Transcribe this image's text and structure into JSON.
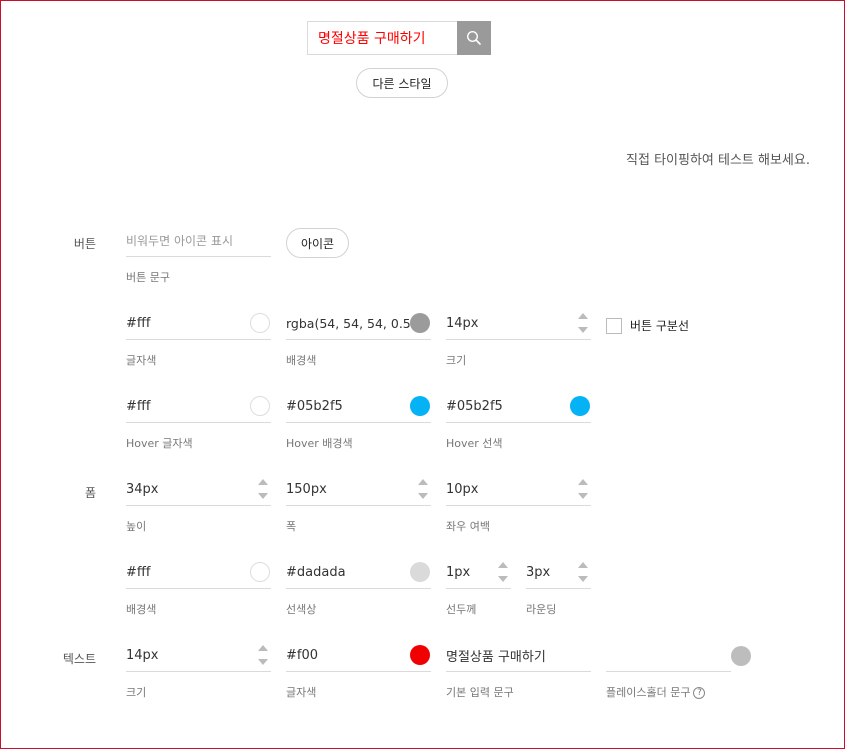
{
  "preview": {
    "input_value": "명절상품 구매하기",
    "text_color": "#f00",
    "button_bg": "rgba(54, 54, 54, 0.5)",
    "button_icon": "search-icon"
  },
  "other_style_label": "다른 스타일",
  "hint": "직접 타이핑하여 테스트 해보세요.",
  "sections": {
    "button": "버튼",
    "form": "폼",
    "text": "텍스트"
  },
  "button": {
    "text_placeholder": "비워두면 아이콘 표시",
    "text_label": "버튼 문구",
    "icon_button_label": "아이콘",
    "font_color": {
      "value": "#fff",
      "label": "글자색",
      "swatch": "#ffffff"
    },
    "bg_color": {
      "value": "rgba(54, 54, 54, 0.5)",
      "label": "배경색",
      "swatch": "#9b9b9b"
    },
    "size": {
      "value": "14px",
      "label": "크기"
    },
    "divider_checkbox": {
      "label": "버튼 구분선",
      "checked": false
    },
    "hover_font_color": {
      "value": "#fff",
      "label": "Hover 글자색",
      "swatch": "#ffffff"
    },
    "hover_bg_color": {
      "value": "#05b2f5",
      "label": "Hover 배경색",
      "swatch": "#05b2f5"
    },
    "hover_line_color": {
      "value": "#05b2f5",
      "label": "Hover 선색",
      "swatch": "#05b2f5"
    }
  },
  "form": {
    "height": {
      "value": "34px",
      "label": "높이"
    },
    "width": {
      "value": "150px",
      "label": "폭"
    },
    "padding": {
      "value": "10px",
      "label": "좌우 여백"
    },
    "bg_color": {
      "value": "#fff",
      "label": "배경색",
      "swatch": "#ffffff"
    },
    "line_color": {
      "value": "#dadada",
      "label": "선색상",
      "swatch": "#dadada"
    },
    "line_width": {
      "value": "1px",
      "label": "선두께"
    },
    "radius": {
      "value": "3px",
      "label": "라운딩"
    }
  },
  "text": {
    "size": {
      "value": "14px",
      "label": "크기"
    },
    "color": {
      "value": "#f00",
      "label": "글자색",
      "swatch": "#f00000"
    },
    "default_text": {
      "value": "명절상품 구매하기",
      "label": "기본 입력 문구"
    },
    "placeholder": {
      "value": "",
      "label": "플레이스홀더 문구",
      "swatch": "#bdbdbd",
      "help_icon": "question-circle-icon"
    }
  }
}
